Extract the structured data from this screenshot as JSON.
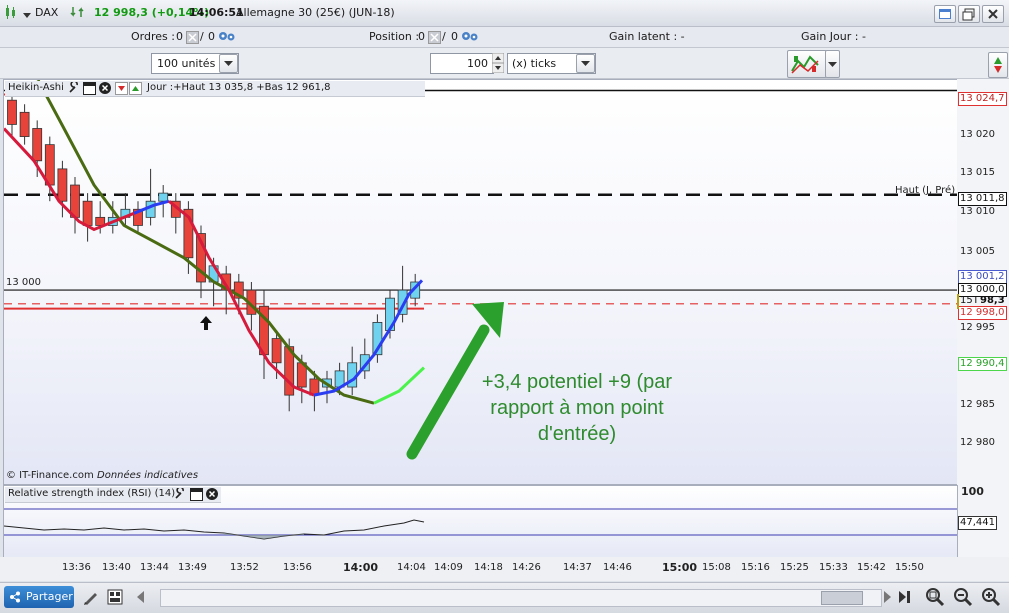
{
  "titlebar": {
    "symbol": "DAX",
    "price": "12 998,3 (+0,14%)",
    "time": "14:06:51",
    "instrument": "Allemagne 30 (25€) (JUN-18)"
  },
  "orderbar": {
    "orders_label": "Ordres :",
    "orders_a": "0",
    "orders_b": "0",
    "position_label": "Position :",
    "position_a": "0",
    "position_b": "0",
    "gain_latent": "Gain latent :  -",
    "gain_jour": "Gain Jour :  -"
  },
  "controls": {
    "units": "100 unités",
    "qty": "100",
    "ticks": "(x) ticks"
  },
  "chart": {
    "indicator_name": "Heikin-Ashi",
    "info": "Jour :+Haut 13 035,8 +Bas 12 961,8",
    "level_13000_label": "13 000",
    "haut_label": "Haut (J, Pré)",
    "copyright": "© IT-Finance.com",
    "disclaimer": "Données indicatives",
    "annotation_line1": "+3,4 potentiel +9 (par",
    "annotation_line2": "rapport à mon point",
    "annotation_line3": "d'entrée)"
  },
  "price_axis": {
    "ticks": [
      "13 020",
      "13 015",
      "13 010",
      "13 005",
      "12 995",
      "12 985",
      "12 980"
    ],
    "tag_top": "13 024,7",
    "tag_haut": "13 011,8",
    "tag_a": "13 001,2",
    "tag_b": "13 000,0",
    "tag_tf": "15T",
    "tag_last": "98,3",
    "tag_low": "12 998,0",
    "tag_ma": "12 990,4"
  },
  "rsi": {
    "title": "Relative strength index (RSI) (14)",
    "scale_top": "100",
    "value": "47,441"
  },
  "time_axis": [
    "13:36",
    "13:40",
    "13:44",
    "13:49",
    "13:52",
    "13:56",
    "14:00",
    "14:04",
    "14:09",
    "14:18",
    "14:26",
    "14:37",
    "14:46",
    "15:00",
    "15:08",
    "15:16",
    "15:25",
    "15:33",
    "15:42",
    "15:50"
  ],
  "bottombar": {
    "share_label": "Partager"
  },
  "colors": {
    "bear": "#e8433a",
    "bull": "#6fd3f0",
    "arrow": "#2ca02c",
    "ma_slow": "#4a6b12",
    "ma_fast_red": "#d61a3c",
    "ma_fast_blue": "#2b3df0",
    "ma_fast_green": "#4cf24c"
  },
  "chart_data": {
    "type": "candlestick",
    "ylim": [
      12976,
      13026
    ],
    "candles": [
      {
        "o": 13023.5,
        "c": 13020.5,
        "h": 13024.5,
        "l": 13019
      },
      {
        "o": 13022,
        "c": 13019,
        "h": 13023,
        "l": 13018
      },
      {
        "o": 13020,
        "c": 13016,
        "h": 13021,
        "l": 13014
      },
      {
        "o": 13018,
        "c": 13013,
        "h": 13019,
        "l": 13011
      },
      {
        "o": 13015,
        "c": 13011,
        "h": 13016,
        "l": 13009
      },
      {
        "o": 13013,
        "c": 13009,
        "h": 13014,
        "l": 13007
      },
      {
        "o": 13011,
        "c": 13008,
        "h": 13012,
        "l": 13006
      },
      {
        "o": 13009,
        "c": 13008,
        "h": 13011,
        "l": 13007
      },
      {
        "o": 13008,
        "c": 13009,
        "h": 13011,
        "l": 13007
      },
      {
        "o": 13009,
        "c": 13010,
        "h": 13012,
        "l": 13008
      },
      {
        "o": 13010,
        "c": 13008,
        "h": 13011,
        "l": 13007
      },
      {
        "o": 13009,
        "c": 13011,
        "h": 13015,
        "l": 13008
      },
      {
        "o": 13011,
        "c": 13012,
        "h": 13013,
        "l": 13009
      },
      {
        "o": 13011,
        "c": 13009,
        "h": 13012,
        "l": 13007
      },
      {
        "o": 13010,
        "c": 13004,
        "h": 13011,
        "l": 13002
      },
      {
        "o": 13007,
        "c": 13001,
        "h": 13008,
        "l": 12999
      },
      {
        "o": 13001,
        "c": 13003,
        "h": 13004,
        "l": 12998
      },
      {
        "o": 13002,
        "c": 13000,
        "h": 13003,
        "l": 12997
      },
      {
        "o": 13001,
        "c": 12999,
        "h": 13002,
        "l": 12997
      },
      {
        "o": 13000,
        "c": 12997,
        "h": 13001,
        "l": 12995
      },
      {
        "o": 12998,
        "c": 12992,
        "h": 13000,
        "l": 12989
      },
      {
        "o": 12994,
        "c": 12991,
        "h": 12995,
        "l": 12989
      },
      {
        "o": 12993,
        "c": 12987,
        "h": 12994,
        "l": 12985
      },
      {
        "o": 12991,
        "c": 12988,
        "h": 12992,
        "l": 12986
      },
      {
        "o": 12989,
        "c": 12987,
        "h": 12990,
        "l": 12985
      },
      {
        "o": 12988,
        "c": 12989,
        "h": 12990,
        "l": 12986
      },
      {
        "o": 12988,
        "c": 12990,
        "h": 12991,
        "l": 12987
      },
      {
        "o": 12988,
        "c": 12991,
        "h": 12993,
        "l": 12987
      },
      {
        "o": 12990,
        "c": 12992,
        "h": 12994,
        "l": 12989
      },
      {
        "o": 12992,
        "c": 12996,
        "h": 12997,
        "l": 12991
      },
      {
        "o": 12995,
        "c": 12999,
        "h": 13000,
        "l": 12994
      },
      {
        "o": 12997,
        "c": 13000,
        "h": 13003,
        "l": 12996
      },
      {
        "o": 12999,
        "c": 13001,
        "h": 13002,
        "l": 12998
      }
    ]
  }
}
